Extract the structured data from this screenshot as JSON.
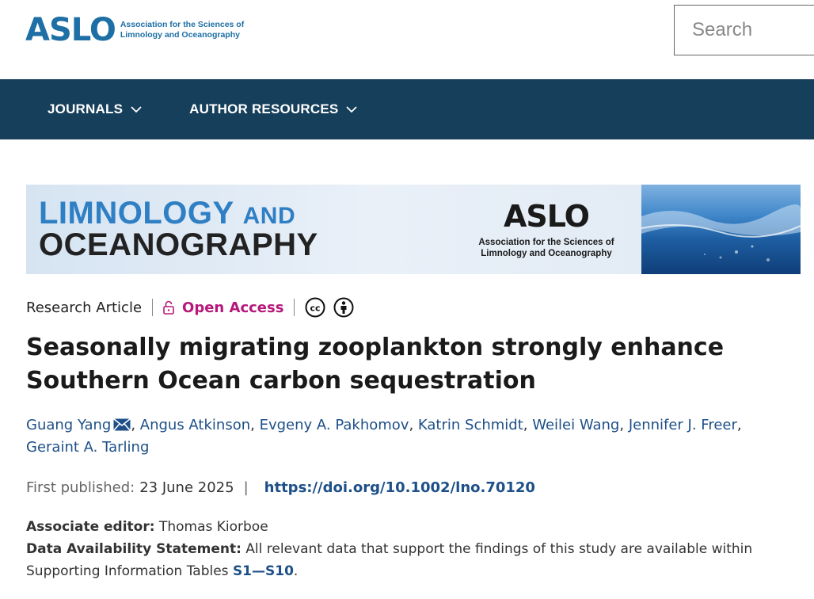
{
  "header": {
    "logo_word": "ASLO",
    "logo_tagline_1": "Association for the Sciences of",
    "logo_tagline_2": "Limnology and Oceanography",
    "search_placeholder": "Search"
  },
  "nav": {
    "items": [
      {
        "label": "JOURNALS"
      },
      {
        "label": "AUTHOR RESOURCES"
      }
    ]
  },
  "banner": {
    "title_line1": "LIMNOLOGY",
    "title_and": "AND",
    "title_line2": "OCEANOGRAPHY",
    "logo_word": "ASLO",
    "logo_tagline_1": "Association for the Sciences of",
    "logo_tagline_2": "Limnology and Oceanography"
  },
  "article": {
    "type": "Research Article",
    "access": "Open Access",
    "title": "Seasonally migrating zooplankton strongly enhance Southern Ocean carbon sequestration",
    "authors": [
      "Guang Yang",
      "Angus Atkinson",
      "Evgeny A. Pakhomov",
      "Katrin Schmidt",
      "Weilei Wang",
      "Jennifer J. Freer",
      "Geraint A. Tarling"
    ],
    "first_published_label": "First published:",
    "first_published_date": "23 June 2025",
    "doi": "https://doi.org/10.1002/lno.70120",
    "associate_editor_label": "Associate editor:",
    "associate_editor": "Thomas Kiorboe",
    "data_statement_label": "Data Availability Statement:",
    "data_statement": "All relevant data that support the findings of this study are available within Supporting Information Tables",
    "data_statement_link": "S1—S10",
    "data_statement_end": "."
  },
  "colors": {
    "nav_bg": "#163f5b",
    "brand_blue": "#1d6fa5",
    "link_blue": "#1d4f88",
    "open_access": "#b5197a"
  },
  "icons": {
    "mail": "envelope-icon",
    "lock": "unlock-icon",
    "cc": "creative-commons-icon",
    "by": "attribution-person-icon",
    "chevron": "chevron-down-icon"
  }
}
